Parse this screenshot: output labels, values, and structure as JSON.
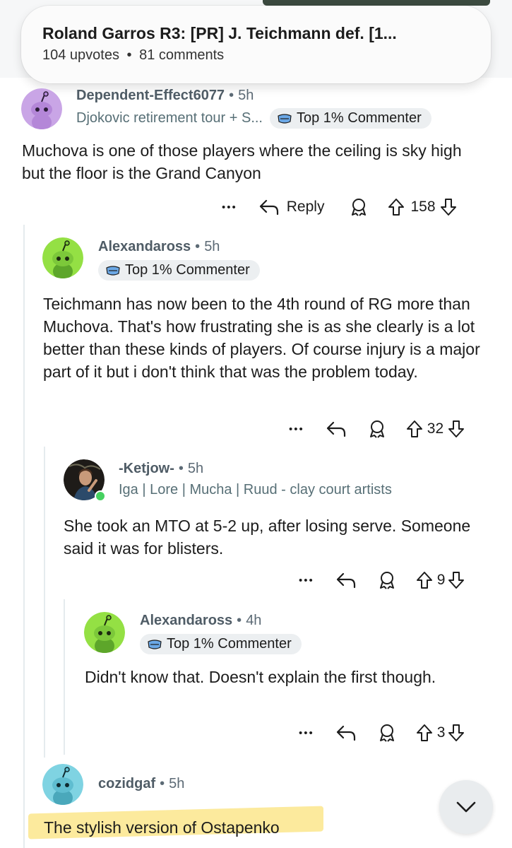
{
  "post": {
    "title": "Roland Garros R3: [PR] J. Teichmann def. [1...",
    "upvotes": "104 upvotes",
    "separator": "•",
    "comments": "81 comments"
  },
  "comments": [
    {
      "author": "Dependent-Effect6077",
      "time": "5h",
      "flair": "Djokovic retirement tour + S...",
      "badge": "Top 1% Commenter",
      "body": "Muchova is one of those players where the ceiling is sky high but the floor is the Grand Canyon",
      "reply_label": "Reply",
      "votes": "158",
      "avatar_color": "#c9a5e6"
    },
    {
      "author": "Alexandaross",
      "time": "5h",
      "badge": "Top 1% Commenter",
      "body": "Teichmann has now been to the 4th round of RG more than Muchova. That's how frustrating she is as she clearly is a lot better than these kinds of players. Of course injury is a major part of it but i don't think that was the problem today.",
      "votes": "32",
      "avatar_color": "#94e044"
    },
    {
      "author": "-Ketjow-",
      "time": "5h",
      "flair": "Iga | Lore | Mucha | Ruud - clay court artists",
      "body": "She took an MTO at 5-2 up, after losing serve. Someone said it was for blisters.",
      "votes": "9",
      "online_color": "#46d160"
    },
    {
      "author": "Alexandaross",
      "time": "4h",
      "badge": "Top 1% Commenter",
      "body": "Didn't know that. Doesn't explain the first though.",
      "votes": "3",
      "avatar_color": "#94e044"
    },
    {
      "author": "cozidgaf",
      "time": "5h",
      "body": "The stylish version of Ostapenko",
      "avatar_color": "#7fd3e2"
    }
  ],
  "ui": {
    "more_glyph": "•••",
    "dot": "•",
    "highlight_color": "#fbe68c"
  }
}
